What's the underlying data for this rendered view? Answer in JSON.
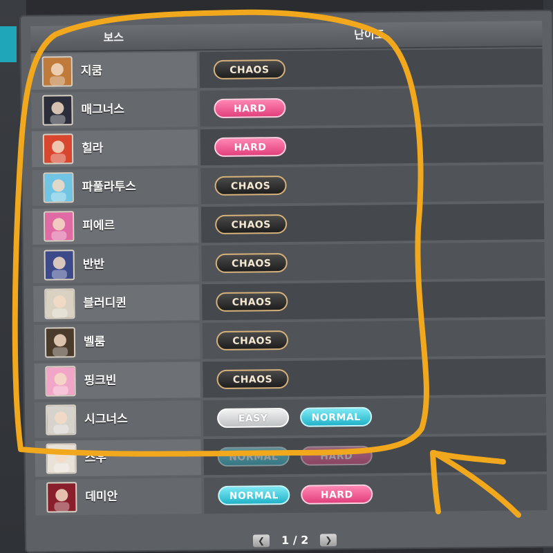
{
  "header": {
    "boss_label": "보스",
    "difficulty_label": "난이도"
  },
  "rows": [
    {
      "name": "지쿰",
      "avatar_icon": "zakum-avatar-icon",
      "avatar_color": "#c07a3a",
      "badges": [
        {
          "label": "CHAOS",
          "type": "chaos"
        }
      ]
    },
    {
      "name": "매그너스",
      "avatar_icon": "magnus-avatar-icon",
      "avatar_color": "#2b2d3a",
      "badges": [
        {
          "label": "HARD",
          "type": "hard"
        }
      ]
    },
    {
      "name": "힐라",
      "avatar_icon": "hilla-avatar-icon",
      "avatar_color": "#d8462e",
      "badges": [
        {
          "label": "HARD",
          "type": "hard"
        }
      ]
    },
    {
      "name": "파풀라투스",
      "avatar_icon": "papulatus-avatar-icon",
      "avatar_color": "#6fc5e3",
      "badges": [
        {
          "label": "CHAOS",
          "type": "chaos"
        }
      ]
    },
    {
      "name": "피에르",
      "avatar_icon": "pierre-avatar-icon",
      "avatar_color": "#e06aa3",
      "badges": [
        {
          "label": "CHAOS",
          "type": "chaos"
        }
      ]
    },
    {
      "name": "반반",
      "avatar_icon": "vonbon-avatar-icon",
      "avatar_color": "#3d4a8a",
      "badges": [
        {
          "label": "CHAOS",
          "type": "chaos"
        }
      ]
    },
    {
      "name": "블러디퀸",
      "avatar_icon": "bloody-queen-avatar-icon",
      "avatar_color": "#d9d2c2",
      "badges": [
        {
          "label": "CHAOS",
          "type": "chaos"
        }
      ]
    },
    {
      "name": "벨룸",
      "avatar_icon": "vellum-avatar-icon",
      "avatar_color": "#4a3b2a",
      "badges": [
        {
          "label": "CHAOS",
          "type": "chaos"
        }
      ]
    },
    {
      "name": "핑크빈",
      "avatar_icon": "pink-bean-avatar-icon",
      "avatar_color": "#f2a6c7",
      "badges": [
        {
          "label": "CHAOS",
          "type": "chaos"
        }
      ]
    },
    {
      "name": "시그너스",
      "avatar_icon": "cygnus-avatar-icon",
      "avatar_color": "#d6d2cc",
      "badges": [
        {
          "label": "EASY",
          "type": "easy"
        },
        {
          "label": "NORMAL",
          "type": "normal"
        }
      ]
    },
    {
      "name": "스우",
      "avatar_icon": "lotus-avatar-icon",
      "avatar_color": "#e8e2d8",
      "badges": [
        {
          "label": "NORMAL",
          "type": "normal",
          "dim": true
        },
        {
          "label": "HARD",
          "type": "hard",
          "dim": true
        }
      ]
    },
    {
      "name": "데미안",
      "avatar_icon": "damien-avatar-icon",
      "avatar_color": "#8a1f2c",
      "badges": [
        {
          "label": "NORMAL",
          "type": "normal"
        },
        {
          "label": "HARD",
          "type": "hard"
        }
      ]
    }
  ],
  "pager": {
    "text": "1 / 2",
    "prev_icon": "chevron-left-icon",
    "next_icon": "chevron-right-icon"
  },
  "colors": {
    "annotation": "#f2a81d"
  }
}
